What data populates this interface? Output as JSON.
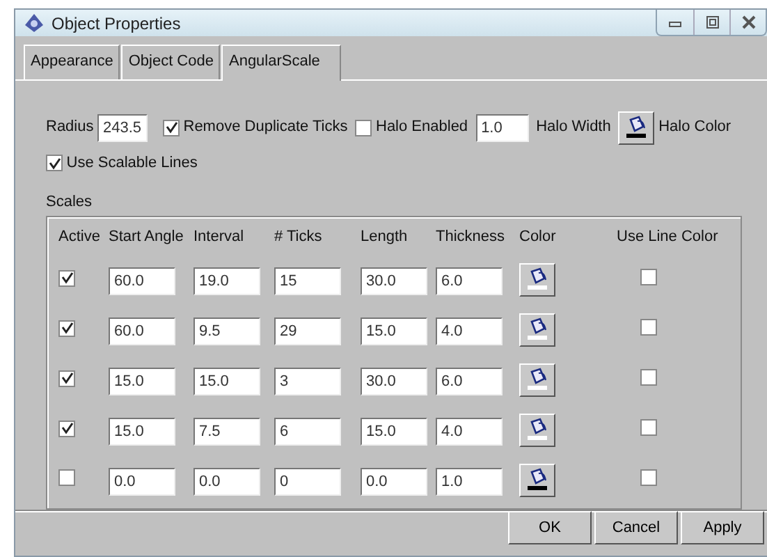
{
  "window": {
    "title": "Object Properties"
  },
  "tabs": [
    {
      "label": "Appearance",
      "selected": false
    },
    {
      "label": "Object Code",
      "selected": false
    },
    {
      "label": "AngularScale",
      "selected": true
    }
  ],
  "radius": {
    "label": "Radius",
    "value": "243.5"
  },
  "remove_duplicate_ticks": {
    "label": "Remove Duplicate Ticks",
    "checked": true
  },
  "halo_enabled": {
    "label": "Halo Enabled",
    "checked": false
  },
  "halo_width": {
    "value": "1.0",
    "label": "Halo Width"
  },
  "halo_color": {
    "label": "Halo Color",
    "color": "#000000"
  },
  "use_scalable_lines": {
    "label": "Use Scalable Lines",
    "checked": true
  },
  "scales": {
    "title": "Scales",
    "columns": [
      "Active",
      "Start Angle",
      "Interval",
      "# Ticks",
      "Length",
      "Thickness",
      "Color",
      "Use Line Color"
    ],
    "rows": [
      {
        "active": true,
        "start_angle": "60.0",
        "interval": "19.0",
        "ticks": "15",
        "length": "30.0",
        "thickness": "6.0",
        "color": "#ffffff",
        "use_line_color": false
      },
      {
        "active": true,
        "start_angle": "60.0",
        "interval": "9.5",
        "ticks": "29",
        "length": "15.0",
        "thickness": "4.0",
        "color": "#ffffff",
        "use_line_color": false
      },
      {
        "active": true,
        "start_angle": "15.0",
        "interval": "15.0",
        "ticks": "3",
        "length": "30.0",
        "thickness": "6.0",
        "color": "#ffffff",
        "use_line_color": false
      },
      {
        "active": true,
        "start_angle": "15.0",
        "interval": "7.5",
        "ticks": "6",
        "length": "15.0",
        "thickness": "4.0",
        "color": "#ffffff",
        "use_line_color": false
      },
      {
        "active": false,
        "start_angle": "0.0",
        "interval": "0.0",
        "ticks": "0",
        "length": "0.0",
        "thickness": "1.0",
        "color": "#000000",
        "use_line_color": false
      }
    ]
  },
  "buttons": [
    "OK",
    "Cancel",
    "Apply"
  ]
}
